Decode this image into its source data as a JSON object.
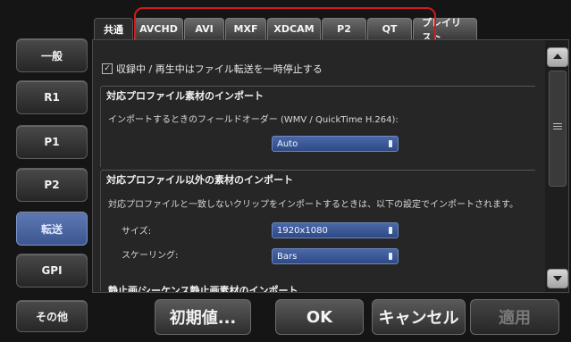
{
  "sidebar": {
    "items": [
      {
        "label": "一般"
      },
      {
        "label": "R1"
      },
      {
        "label": "P1"
      },
      {
        "label": "P2"
      },
      {
        "label": "転送",
        "active": true
      },
      {
        "label": "GPI"
      },
      {
        "label": "その他"
      }
    ]
  },
  "tabs": [
    {
      "label": "共通",
      "active": true
    },
    {
      "label": "AVCHD"
    },
    {
      "label": "AVI"
    },
    {
      "label": "MXF"
    },
    {
      "label": "XDCAM"
    },
    {
      "label": "P2"
    },
    {
      "label": "QT"
    },
    {
      "label": "プレイリスト"
    }
  ],
  "highlight_color": "#d21a1a",
  "content": {
    "pause_checkbox": {
      "checked": true,
      "label": "収録中 / 再生中はファイル転送を一時停止する"
    },
    "supported_import": {
      "title": "対応プロファイル素材のインポート",
      "desc": "インポートするときのフィールドオーダー (WMV / QuickTime H.264):",
      "field_order": "Auto"
    },
    "unsupported_import": {
      "title": "対応プロファイル以外の素材のインポート",
      "desc": "対応プロファイルと一致しないクリップをインポートするときは、以下の設定でインポートされます。",
      "size_label": "サイズ:",
      "size_value": "1920x1080",
      "scaling_label": "スケーリング:",
      "scaling_value": "Bars"
    },
    "partial_title": "静止画/シーケンス静止画素材のインポート"
  },
  "buttons": {
    "defaults": "初期値...",
    "ok": "OK",
    "cancel": "キャンセル",
    "apply": "適用"
  }
}
